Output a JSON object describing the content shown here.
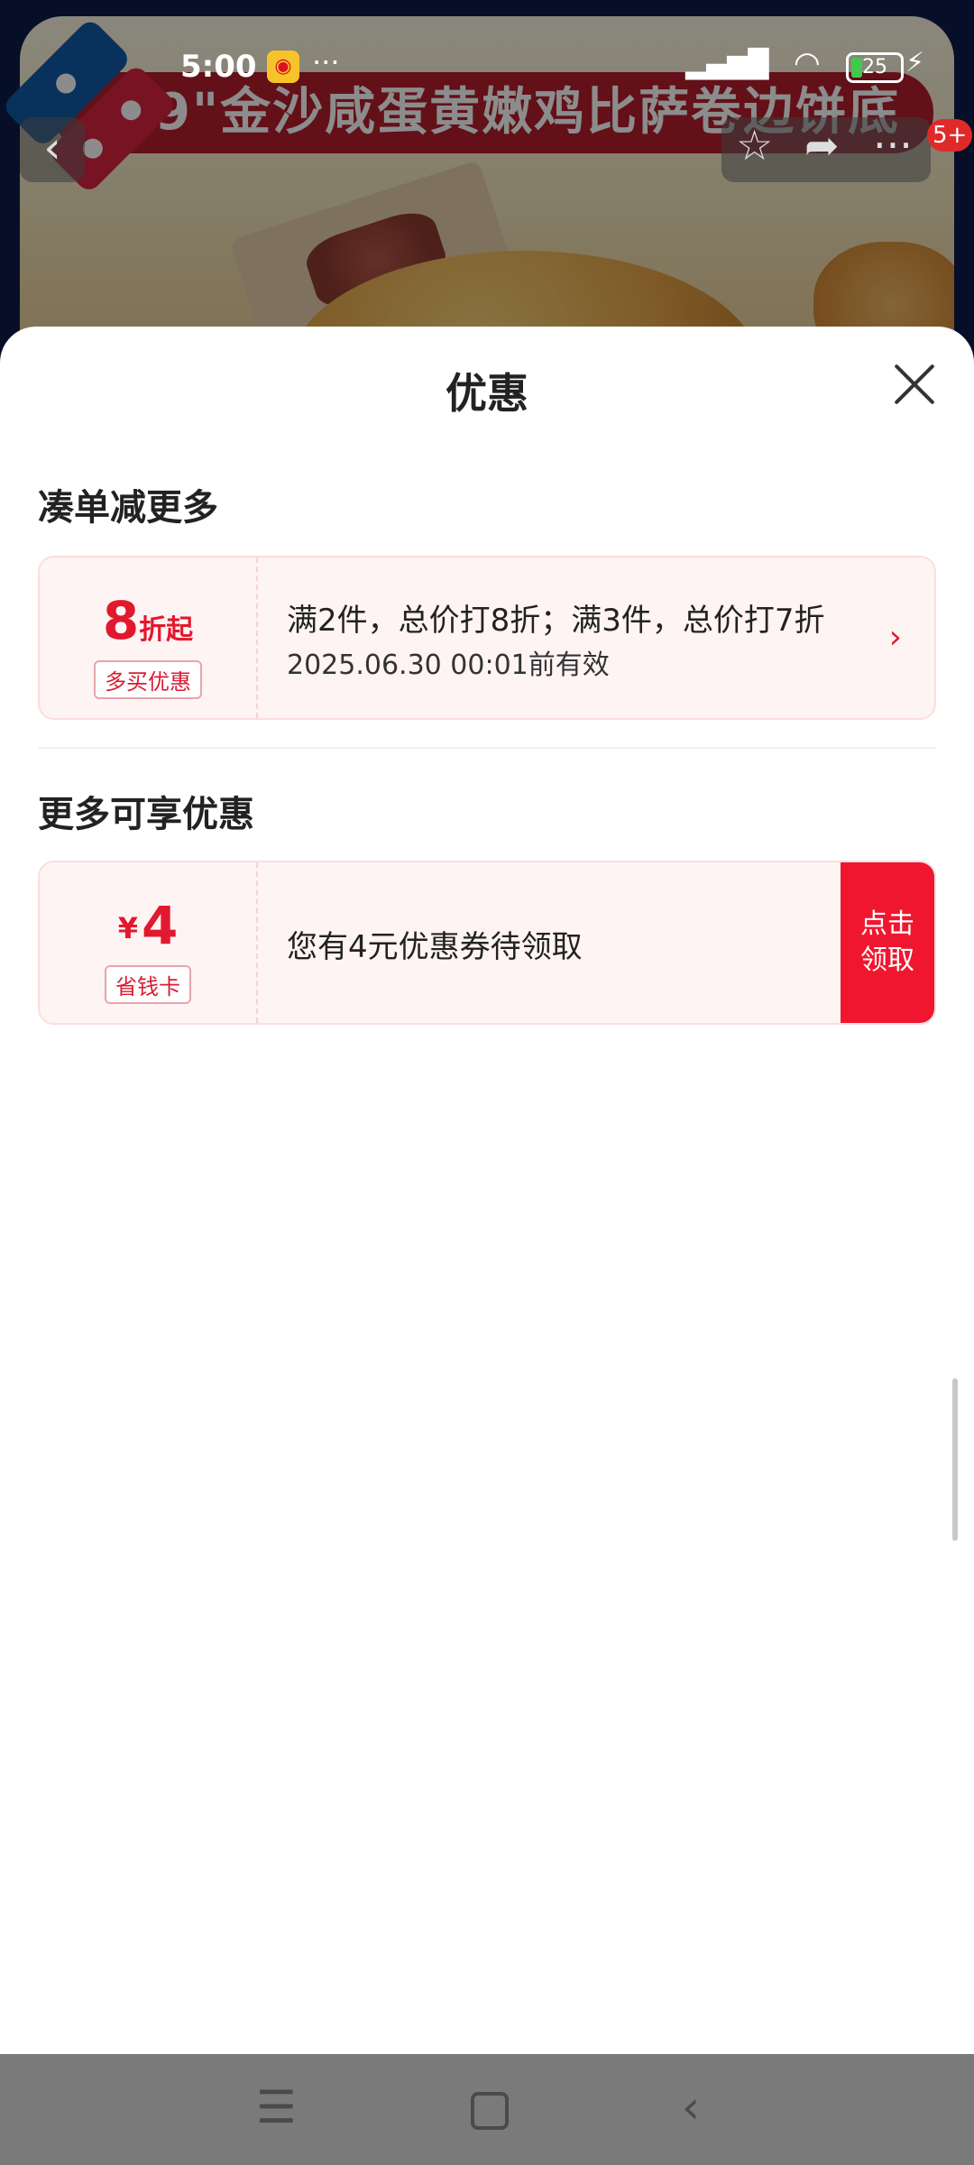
{
  "status_bar": {
    "time": "5:00",
    "more": "···",
    "battery": "25"
  },
  "background_page": {
    "banner_title": "9\"金沙咸蛋黄嫩鸡比萨卷边饼底",
    "cart_badge": "5+"
  },
  "sheet": {
    "title": "优惠",
    "section1_title": "凑单减更多",
    "section2_title": "更多可享优惠",
    "cards": [
      {
        "value_number": "8",
        "value_suffix": "折起",
        "tag": "多买优惠",
        "description": "满2件，总价打8折；满3件，总价打7折",
        "valid_until": "2025.06.30 00:01前有效"
      },
      {
        "currency": "¥",
        "value_number": "4",
        "tag": "省钱卡",
        "description": "您有4元优惠券待领取",
        "button_line1": "点击",
        "button_line2": "领取"
      }
    ]
  },
  "colors": {
    "accent": "#e2192e",
    "card_bg": "#fff4f4",
    "nav_bar": "#7a7a7a"
  }
}
